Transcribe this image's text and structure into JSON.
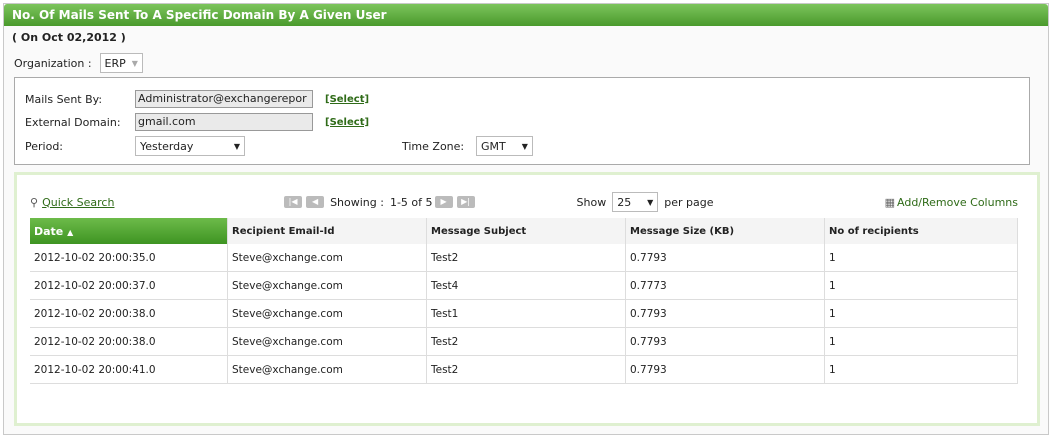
{
  "title": "No. Of Mails Sent To A Specific Domain By A Given User",
  "subtitle": "( On Oct 02,2012 )",
  "organization": {
    "label": "Organization :",
    "value": "ERP"
  },
  "filters": {
    "mails_sent_by_label": "Mails Sent By:",
    "mails_sent_by": "Administrator@exchangerepor",
    "external_domain_label": "External Domain:",
    "external_domain": "gmail.com",
    "select_label": "[Select]",
    "period_label": "Period:",
    "period": "Yesterday",
    "timezone_label": "Time Zone:",
    "timezone": "GMT"
  },
  "toolbar": {
    "quick_search": "Quick Search",
    "showing_label": "Showing :",
    "showing": "1-5 of 5",
    "show_label": "Show",
    "per_page": "25",
    "per_page_label": "per page",
    "add_remove": "Add/Remove Columns"
  },
  "table": {
    "columns": [
      "Date",
      "Recipient Email-Id",
      "Message Subject",
      "Message Size (KB)",
      "No of recipients"
    ],
    "rows": [
      [
        "2012-10-02 20:00:35.0",
        "Steve@xchange.com",
        "Test2",
        "0.7793",
        "1"
      ],
      [
        "2012-10-02 20:00:37.0",
        "Steve@xchange.com",
        "Test4",
        "0.7773",
        "1"
      ],
      [
        "2012-10-02 20:00:38.0",
        "Steve@xchange.com",
        "Test1",
        "0.7793",
        "1"
      ],
      [
        "2012-10-02 20:00:38.0",
        "Steve@xchange.com",
        "Test2",
        "0.7793",
        "1"
      ],
      [
        "2012-10-02 20:00:41.0",
        "Steve@xchange.com",
        "Test2",
        "0.7793",
        "1"
      ]
    ]
  }
}
